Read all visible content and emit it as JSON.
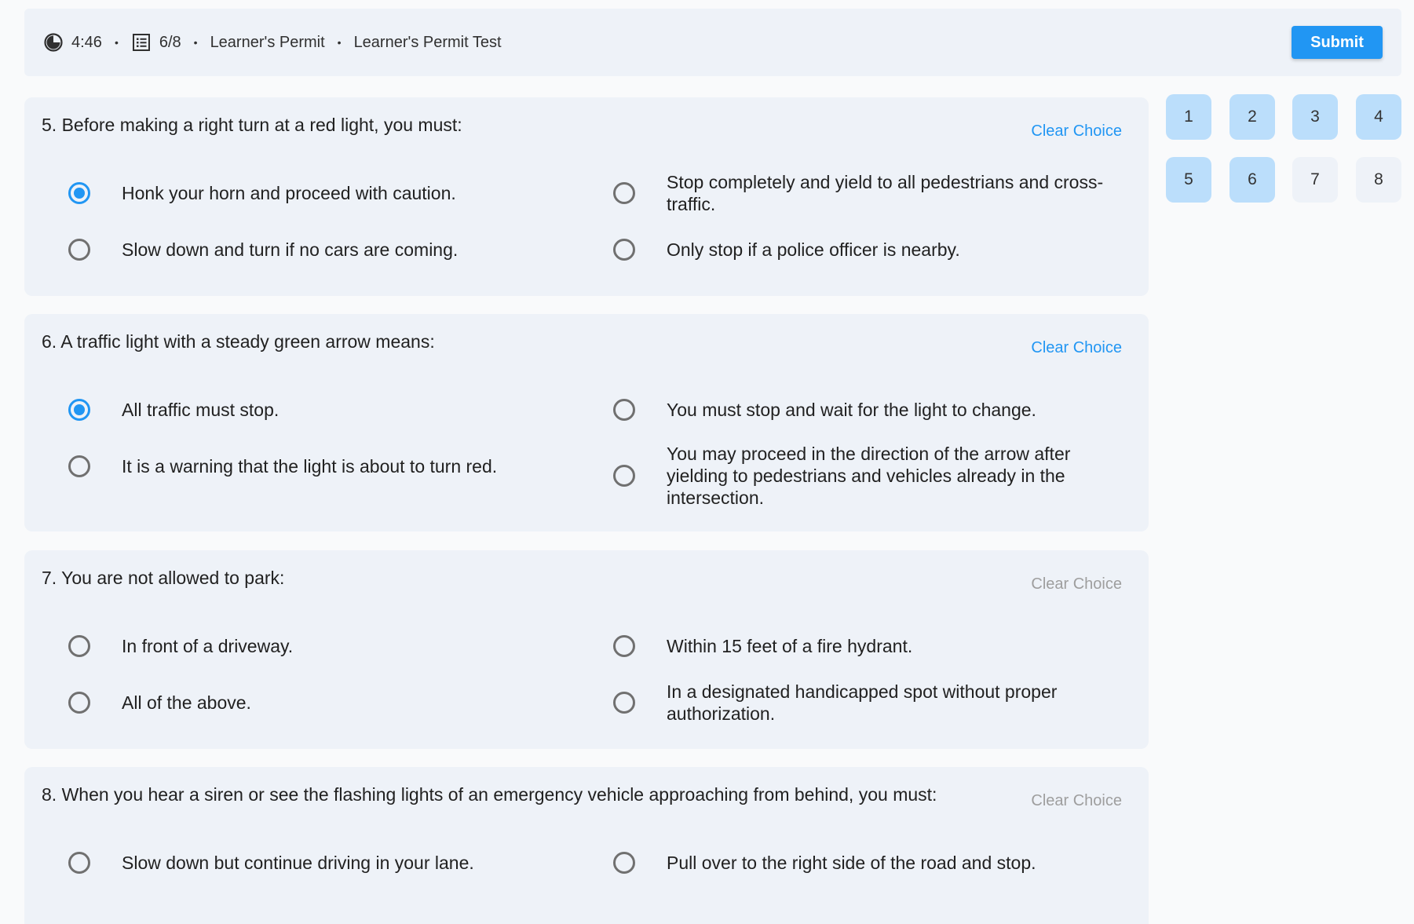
{
  "header": {
    "timer_icon": "timer-icon",
    "timer": "4:46",
    "progress_icon": "list-icon",
    "progress": "6/8",
    "sep": "•",
    "category": "Learner's Permit",
    "test_name": "Learner's Permit Test",
    "submit_label": "Submit"
  },
  "questions": [
    {
      "title": "5. Before making a right turn at a red light, you must:",
      "clear_label": "Clear Choice",
      "clear_enabled": true,
      "options": [
        {
          "label": "Honk your horn and proceed with caution.",
          "selected": true
        },
        {
          "label": "Stop completely and yield to all pedestrians and cross-traffic.",
          "selected": false
        },
        {
          "label": "Slow down and turn if no cars are coming.",
          "selected": false
        },
        {
          "label": "Only stop if a police officer is nearby.",
          "selected": false
        }
      ]
    },
    {
      "title": "6. A traffic light with a steady green arrow means:",
      "clear_label": "Clear Choice",
      "clear_enabled": true,
      "options": [
        {
          "label": "All traffic must stop.",
          "selected": true
        },
        {
          "label": "You must stop and wait for the light to change.",
          "selected": false
        },
        {
          "label": "It is a warning that the light is about to turn red.",
          "selected": false
        },
        {
          "label": "You may proceed in the direction of the arrow after yielding to pedestrians and vehicles already in the intersection.",
          "selected": false
        }
      ]
    },
    {
      "title": "7. You are not allowed to park:",
      "clear_label": "Clear Choice",
      "clear_enabled": false,
      "options": [
        {
          "label": "In front of a driveway.",
          "selected": false
        },
        {
          "label": "Within 15 feet of a fire hydrant.",
          "selected": false
        },
        {
          "label": "All of the above.",
          "selected": false
        },
        {
          "label": "In a designated handicapped spot without proper authorization.",
          "selected": false
        }
      ]
    },
    {
      "title": "8. When you hear a siren or see the flashing lights of an emergency vehicle approaching from behind, you must:",
      "clear_label": "Clear Choice",
      "clear_enabled": false,
      "options": [
        {
          "label": "Slow down but continue driving in your lane.",
          "selected": false
        },
        {
          "label": "Pull over to the right side of the road and stop.",
          "selected": false
        }
      ]
    }
  ],
  "navigator": [
    {
      "label": "1",
      "answered": true
    },
    {
      "label": "2",
      "answered": true
    },
    {
      "label": "3",
      "answered": true
    },
    {
      "label": "4",
      "answered": true
    },
    {
      "label": "5",
      "answered": true
    },
    {
      "label": "6",
      "answered": true
    },
    {
      "label": "7",
      "answered": false
    },
    {
      "label": "8",
      "answered": false
    }
  ],
  "colors": {
    "accent": "#2196f3",
    "card_bg": "#eef2f8",
    "answered_bg": "#bbdefb"
  }
}
